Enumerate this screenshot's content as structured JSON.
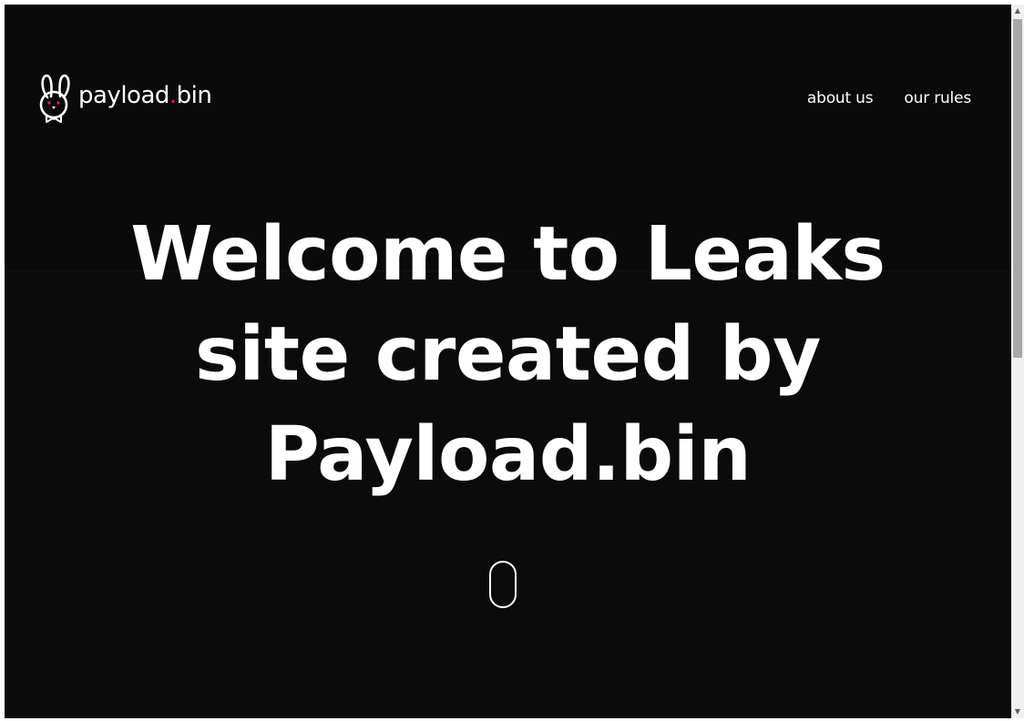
{
  "brand": {
    "name_part1": "payload",
    "name_dot": ".",
    "name_part2": "bin",
    "icon": "bunny-bowtie-icon",
    "accent_color": "#e11d48"
  },
  "nav": {
    "items": [
      {
        "label": "about us"
      },
      {
        "label": "our rules"
      }
    ]
  },
  "hero": {
    "lines": [
      "Welcome to Leaks",
      "site created by",
      "Payload.bin"
    ]
  },
  "scroll_indicator": {
    "icon": "mouse-scroll-icon"
  },
  "colors": {
    "background": "#0c0b0c",
    "text": "#ffffff"
  }
}
